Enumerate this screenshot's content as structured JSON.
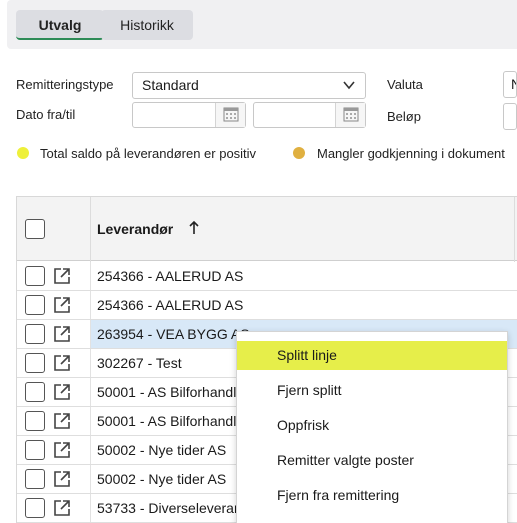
{
  "tabs": [
    {
      "label": "Utvalg",
      "active": true
    },
    {
      "label": "Historikk",
      "active": false
    }
  ],
  "filters": {
    "remitteringstype_label": "Remitteringstype",
    "remitteringstype_value": "Standard",
    "dato_label": "Dato fra/til",
    "dato_fra": "",
    "dato_til": "",
    "valuta_label": "Valuta",
    "valuta_value": "N",
    "belop_label": "Beløp",
    "belop_value": ""
  },
  "legend": [
    {
      "text": "Total saldo på leverandøren er positiv",
      "color": "#eef03a"
    },
    {
      "text": "Mangler godkjenning i dokument",
      "color": "#e0b040"
    }
  ],
  "grid": {
    "column_header": "Leverandør",
    "sort_direction": "ascending",
    "rows": [
      {
        "leverandor": "254366 - AALERUD AS",
        "selected": false
      },
      {
        "leverandor": "254366 - AALERUD AS",
        "selected": false
      },
      {
        "leverandor": "263954 - VEA BYGG AS",
        "selected": true
      },
      {
        "leverandor": "302267 - Test",
        "selected": false
      },
      {
        "leverandor": "50001 - AS Bilforhandler",
        "selected": false
      },
      {
        "leverandor": "50001 - AS Bilforhandler",
        "selected": false
      },
      {
        "leverandor": "50002 - Nye tider AS",
        "selected": false
      },
      {
        "leverandor": "50002 - Nye tider AS",
        "selected": false
      },
      {
        "leverandor": "53733 - Diverseleverandør",
        "selected": false
      }
    ]
  },
  "context_menu": {
    "items": [
      {
        "label": "Splitt linje",
        "highlighted": true
      },
      {
        "label": "Fjern splitt",
        "highlighted": false
      },
      {
        "label": "Oppfrisk",
        "highlighted": false
      },
      {
        "label": "Remitter valgte poster",
        "highlighted": false
      },
      {
        "label": "Fjern fra remittering",
        "highlighted": false
      }
    ]
  },
  "colors": {
    "tab_active_underline": "#2e8b57",
    "selected_row": "#d8e8f7",
    "menu_highlight": "#e6ee4a"
  }
}
